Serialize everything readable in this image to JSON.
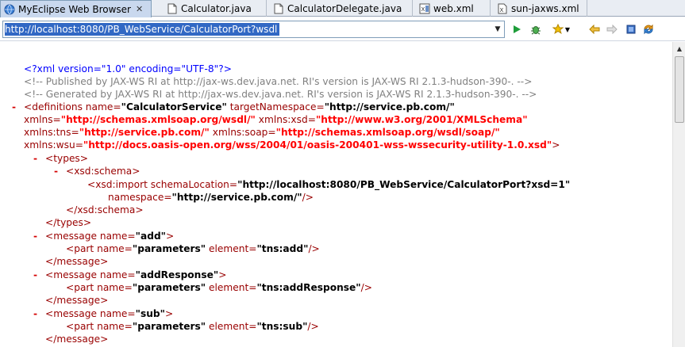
{
  "tabs": [
    {
      "label": "MyEclipse Web Browser",
      "icon": "browser-globe-icon",
      "active": true,
      "close": "✕"
    },
    {
      "label": "Calculator.java",
      "icon": "java-file-icon"
    },
    {
      "label": "CalculatorDelegate.java",
      "icon": "java-file-icon"
    },
    {
      "label": "web.xml",
      "icon": "xml-file-icon"
    },
    {
      "label": "sun-jaxws.xml",
      "icon": "xml-file-icon"
    }
  ],
  "address": {
    "url": "http://localhost:8080/PB_WebService/CalculatorPort?wsdl"
  },
  "toolbar": [
    "go-icon",
    "debug-icon",
    "favorites-icon",
    "back-icon",
    "forward-icon",
    "stop-icon",
    "refresh-icon"
  ],
  "xml": {
    "pi": "<?xml version=\"1.0\" encoding=\"UTF-8\"?>",
    "comment1": "<!-- Published by JAX-WS RI at http://jax-ws.dev.java.net. RI's version is JAX-WS RI 2.1.3-hudson-390-. -->",
    "comment2": "<!-- Generated by JAX-WS RI at http://jax-ws.dev.java.net. RI's version is JAX-WS RI 2.1.3-hudson-390-. -->",
    "minus": "-",
    "def": {
      "open": "<definitions",
      "name_attr": " name=",
      "name_val": "\"CalculatorService\"",
      "tns_attr": " targetNamespace=",
      "tns_val": "\"http://service.pb.com/\"",
      "xmlns_attr": "xmlns=",
      "xmlns_val": "\"http://schemas.xmlsoap.org/wsdl/\"",
      "xsd_attr": " xmlns:xsd=",
      "xsd_val": "\"http://www.w3.org/2001/XMLSchema\"",
      "tnsns_attr": "xmlns:tns=",
      "tnsns_val": "\"http://service.pb.com/\"",
      "soap_attr": " xmlns:soap=",
      "soap_val": "\"http://schemas.xmlsoap.org/wsdl/soap/\"",
      "wsu_attr": "xmlns:wsu=",
      "wsu_val": "\"http://docs.oasis-open.org/wss/2004/01/oasis-200401-wss-wssecurity-utility-1.0.xsd\"",
      "close": ">"
    },
    "types_open": "<types>",
    "schema_open": "<xsd:schema>",
    "import_open": "<xsd:import",
    "import_loc_attr": " schemaLocation=",
    "import_loc_val": "\"http://localhost:8080/PB_WebService/CalculatorPort?xsd=1\"",
    "import_ns_attr": "namespace=",
    "import_ns_val": "\"http://service.pb.com/\"",
    "import_close": "/>",
    "schema_close": "</xsd:schema>",
    "types_close": "</types>",
    "msg_open": "<message",
    "msg_name_attr": " name=",
    "tag_close": ">",
    "part_open": "<part",
    "part_name_attr": " name=",
    "part_name_val": "\"parameters\"",
    "part_el_attr": " element=",
    "self_close": "/>",
    "msg_close": "</message>",
    "messages": [
      {
        "name": "\"add\"",
        "element": "\"tns:add\""
      },
      {
        "name": "\"addResponse\"",
        "element": "\"tns:addResponse\""
      },
      {
        "name": "\"sub\"",
        "element": "\"tns:sub\""
      }
    ]
  }
}
